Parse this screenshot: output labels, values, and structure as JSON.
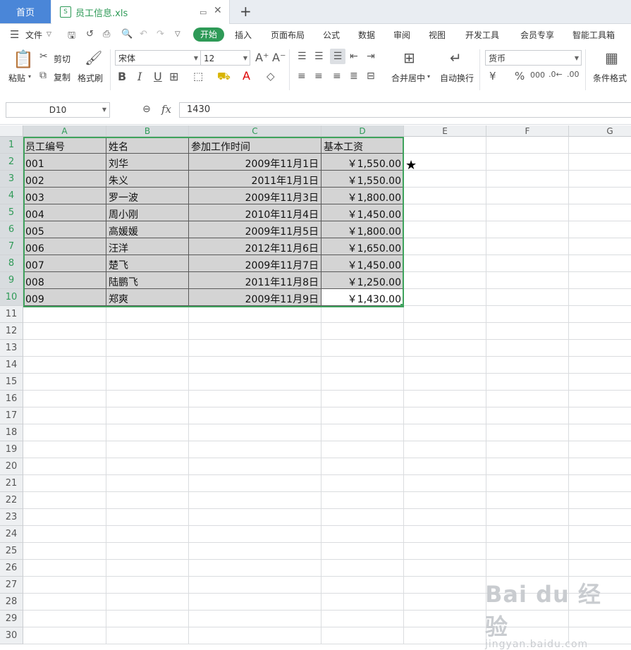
{
  "tabs": {
    "home": "首页",
    "file": "员工信息.xls"
  },
  "menu": {
    "file": "文件",
    "items": [
      "开始",
      "插入",
      "页面布局",
      "公式",
      "数据",
      "审阅",
      "视图",
      "开发工具",
      "会员专享",
      "智能工具箱"
    ]
  },
  "ribbon": {
    "paste": "粘贴",
    "cut": "剪切",
    "copy": "复制",
    "format_painter": "格式刷",
    "font_name": "宋体",
    "font_size": "12",
    "merge_center": "合并居中",
    "wrap_text": "自动换行",
    "number_format": "货币",
    "conditional_format": "条件格式"
  },
  "formula_bar": {
    "cell_ref": "D10",
    "fx": "fx",
    "value": "1430"
  },
  "columns": [
    "A",
    "B",
    "C",
    "D",
    "E",
    "F",
    "G"
  ],
  "rows": [
    "1",
    "2",
    "3",
    "4",
    "5",
    "6",
    "7",
    "8",
    "9",
    "10",
    "11",
    "12",
    "13",
    "14",
    "15",
    "16",
    "17",
    "18",
    "19",
    "20",
    "21",
    "22",
    "23",
    "24",
    "25",
    "26",
    "27",
    "28",
    "29",
    "30"
  ],
  "table": {
    "headers": [
      "员工编号",
      "姓名",
      "参加工作时间",
      "基本工资"
    ],
    "rows": [
      [
        "001",
        "刘华",
        "2009年11月1日",
        "￥1,550.00"
      ],
      [
        "002",
        "朱义",
        "2011年1月1日",
        "￥1,550.00"
      ],
      [
        "003",
        "罗一波",
        "2009年11月3日",
        "￥1,800.00"
      ],
      [
        "004",
        "周小刚",
        "2010年11月4日",
        "￥1,450.00"
      ],
      [
        "005",
        "高媛媛",
        "2009年11月5日",
        "￥1,800.00"
      ],
      [
        "006",
        "汪洋",
        "2012年11月6日",
        "￥1,650.00"
      ],
      [
        "007",
        "楚飞",
        "2009年11月7日",
        "￥1,450.00"
      ],
      [
        "008",
        "陆鹏飞",
        "2011年11月8日",
        "￥1,250.00"
      ],
      [
        "009",
        "郑爽",
        "2009年11月9日",
        "￥1,430.00"
      ]
    ]
  },
  "marker": "★",
  "watermark": {
    "main": "Bai du 经验",
    "sub": "jingyan.baidu.com"
  },
  "colors": {
    "accent_green": "#2e9a57",
    "tab_blue": "#4a86d8",
    "selection_fill": "#d4d4d4"
  }
}
